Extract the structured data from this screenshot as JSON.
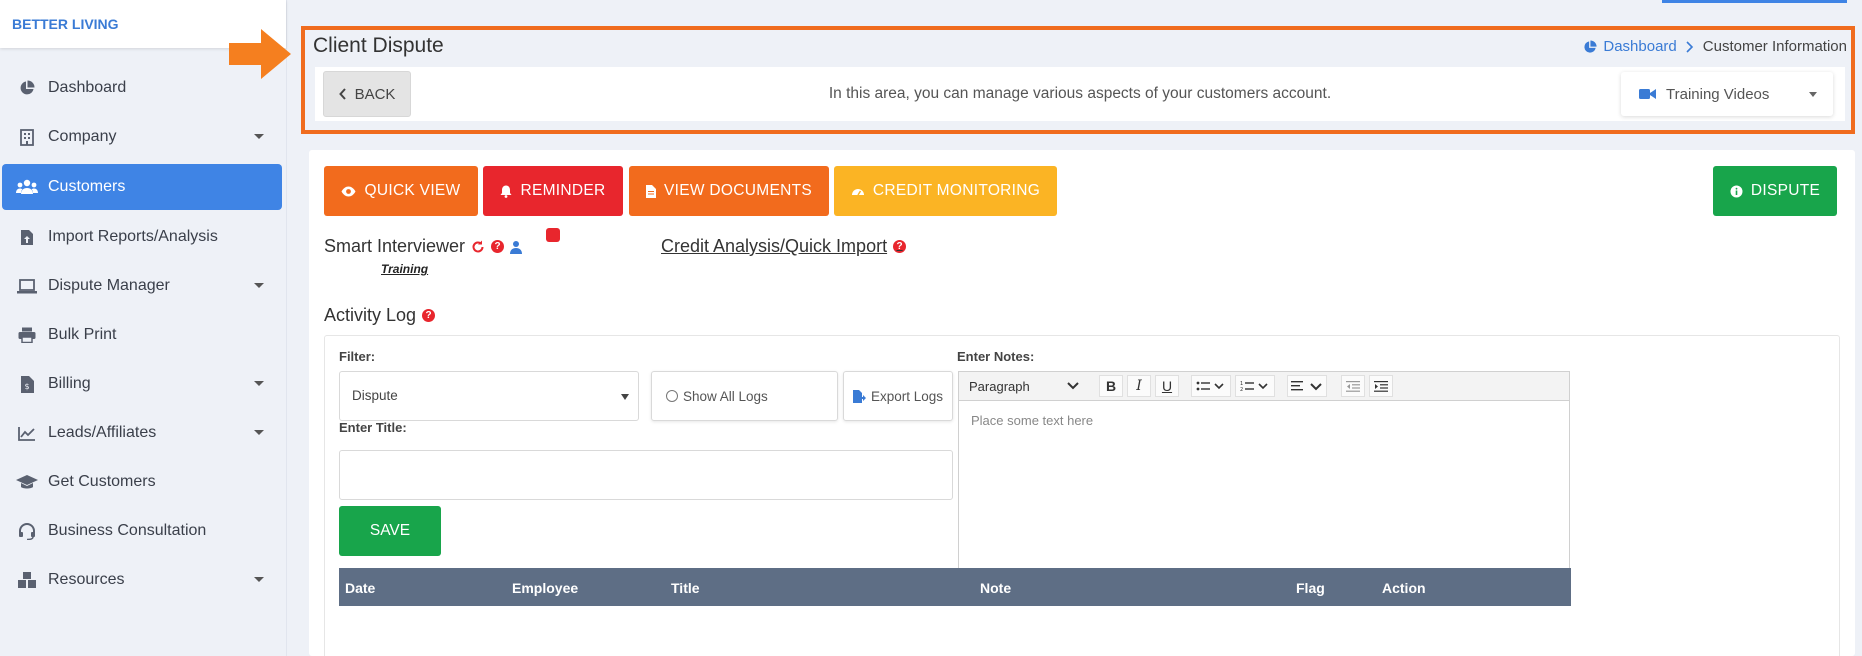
{
  "brand": "BETTER LIVING",
  "sidebar": {
    "items": [
      {
        "label": "Dashboard",
        "icon": "pie-chart-icon",
        "dropdown": false
      },
      {
        "label": "Company",
        "icon": "building-icon",
        "dropdown": true
      },
      {
        "label": "Customers",
        "icon": "users-icon",
        "dropdown": false,
        "active": true
      },
      {
        "label": "Import Reports/Analysis",
        "icon": "file-upload-icon",
        "dropdown": false
      },
      {
        "label": "Dispute Manager",
        "icon": "laptop-icon",
        "dropdown": true
      },
      {
        "label": "Bulk Print",
        "icon": "printer-icon",
        "dropdown": false
      },
      {
        "label": "Billing",
        "icon": "invoice-icon",
        "dropdown": true
      },
      {
        "label": "Leads/Affiliates",
        "icon": "line-chart-icon",
        "dropdown": true
      },
      {
        "label": "Get Customers",
        "icon": "graduation-cap-icon",
        "dropdown": false
      },
      {
        "label": "Business Consultation",
        "icon": "headset-icon",
        "dropdown": false
      },
      {
        "label": "Resources",
        "icon": "boxes-icon",
        "dropdown": true
      }
    ]
  },
  "header": {
    "title": "Client Dispute",
    "breadcrumb": {
      "link": "Dashboard",
      "current": "Customer Information"
    },
    "back_label": "BACK",
    "message": "In this area, you can manage various aspects of your customers account.",
    "training_videos": "Training Videos"
  },
  "actions": {
    "quick_view": "QUICK VIEW",
    "reminder": "REMINDER",
    "view_documents": "VIEW DOCUMENTS",
    "credit_monitoring": "CREDIT MONITORING",
    "dispute": "DISPUTE"
  },
  "smart_interviewer": {
    "label": "Smart Interviewer",
    "training": "Training"
  },
  "credit_analysis": "Credit Analysis/Quick Import",
  "activity_log": {
    "title": "Activity Log",
    "filter_label": "Filter:",
    "filter_value": "Dispute",
    "show_all": "Show All Logs",
    "export": "Export Logs",
    "title_label": "Enter Title:",
    "save": "SAVE",
    "notes_label": "Enter Notes:",
    "editor": {
      "paragraph": "Paragraph",
      "placeholder": "Place some text here"
    },
    "columns": [
      "Date",
      "Employee",
      "Title",
      "Note",
      "Flag",
      "Action"
    ]
  },
  "colors": {
    "accent": "#3f84e5",
    "orange": "#f26b1d",
    "red": "#e8262d",
    "yellow": "#fbb424",
    "green": "#18a54b",
    "table_header": "#5e6e85",
    "highlight_border": "#f06c1e"
  }
}
